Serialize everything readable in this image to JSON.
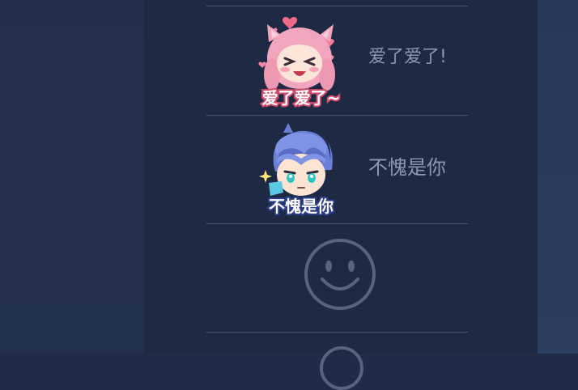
{
  "stickers": [
    {
      "icon": "cat-girl-love-sticker",
      "sticker_text": "爱了爱了~",
      "caption": "爱了爱了!"
    },
    {
      "icon": "blue-hair-boy-sticker",
      "sticker_text": "不愧是你",
      "caption": "不愧是你"
    }
  ],
  "smiley_icon": "smiley-face-icon",
  "colors": {
    "background": "#1f2b47",
    "panel": "#1e2a44",
    "divider": "#4a5a7a",
    "caption_text": "#8c99b4",
    "icon_outline": "#56647f"
  }
}
